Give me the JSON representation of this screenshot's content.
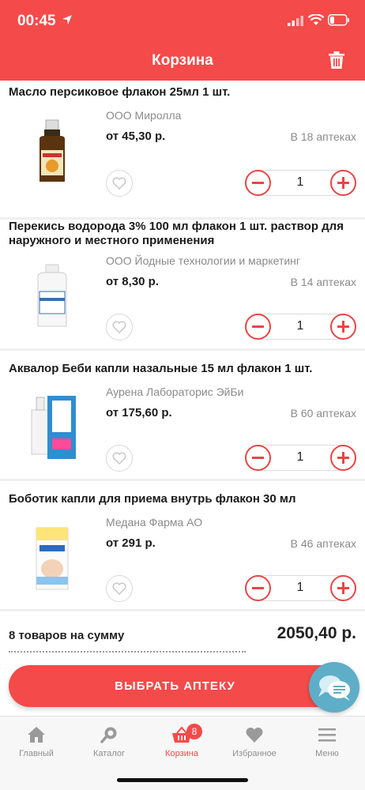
{
  "status": {
    "time": "00:45"
  },
  "header": {
    "title": "Корзина"
  },
  "items": [
    {
      "title": "Масло персиковое флакон 25мл 1 шт.",
      "maker": "ООО Миролла",
      "price": "от 45,30 р.",
      "pharmacies": "В 18 аптеках",
      "quantity": "1"
    },
    {
      "title": "Перекись водорода 3% 100 мл флакон 1 шт. раствор для наружного и местного применения",
      "maker": "ООО Йодные технологии и маркетинг",
      "price": "от 8,30 р.",
      "pharmacies": "В 14 аптеках",
      "quantity": "1"
    },
    {
      "title": "Аквалор Беби капли назальные 15 мл флакон 1 шт.",
      "maker": "Аурена Лабораторис ЭйБи",
      "price": "от 175,60 р.",
      "pharmacies": "В 60 аптеках",
      "quantity": "1"
    },
    {
      "title": "Боботик капли для приема внутрь флакон 30 мл",
      "maker": "Медана Фарма АО",
      "price": "от 291 р.",
      "pharmacies": "В 46 аптеках",
      "quantity": "1"
    }
  ],
  "summary": {
    "label": "8 товаров на сумму",
    "total": "2050,40 р."
  },
  "actions": {
    "choose_pharmacy": "ВЫБРАТЬ АПТЕКУ"
  },
  "tabs": [
    {
      "label": "Главный",
      "icon": "home-icon"
    },
    {
      "label": "Каталог",
      "icon": "search-icon"
    },
    {
      "label": "Корзина",
      "icon": "basket-icon",
      "badge": "8",
      "active": true
    },
    {
      "label": "Избранное",
      "icon": "heart-icon"
    },
    {
      "label": "Меню",
      "icon": "menu-icon"
    }
  ],
  "colors": {
    "accent": "#f44a4a",
    "chat": "#5eaec8"
  }
}
